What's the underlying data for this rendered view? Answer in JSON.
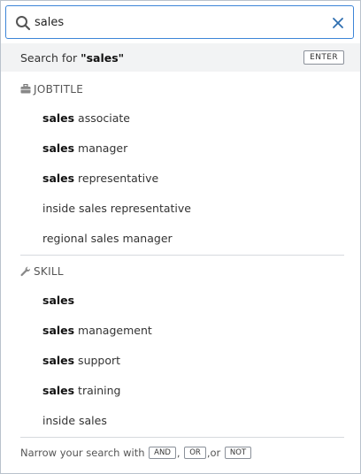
{
  "search": {
    "value": "sales",
    "search_for_prefix": "Search for ",
    "search_for_term": "\"sales\"",
    "enter_key": "ENTER"
  },
  "jobtitle": {
    "header": "JOBTITLE",
    "items": [
      {
        "bold": "sales",
        "rest": " associate"
      },
      {
        "bold": "sales",
        "rest": " manager"
      },
      {
        "bold": "sales",
        "rest": " representative"
      },
      {
        "bold": "",
        "rest": "inside sales representative"
      },
      {
        "bold": "",
        "rest": "regional sales manager"
      }
    ]
  },
  "skill": {
    "header": "SKILL",
    "items": [
      {
        "bold": "sales",
        "rest": ""
      },
      {
        "bold": "sales",
        "rest": " management"
      },
      {
        "bold": "sales",
        "rest": " support"
      },
      {
        "bold": "sales",
        "rest": " training"
      },
      {
        "bold": "",
        "rest": "inside sales"
      }
    ]
  },
  "footer": {
    "text": "Narrow your search with ",
    "and": "AND",
    "sep1": ",",
    "or": "OR",
    "sep2": ",or",
    "not": "NOT"
  },
  "icons": {
    "search": "search-icon",
    "close": "close-icon",
    "jobtitle": "briefcase-icon",
    "skill": "wrench-icon"
  },
  "colors": {
    "accent": "#3c85d8",
    "close": "#2f6fb0"
  }
}
